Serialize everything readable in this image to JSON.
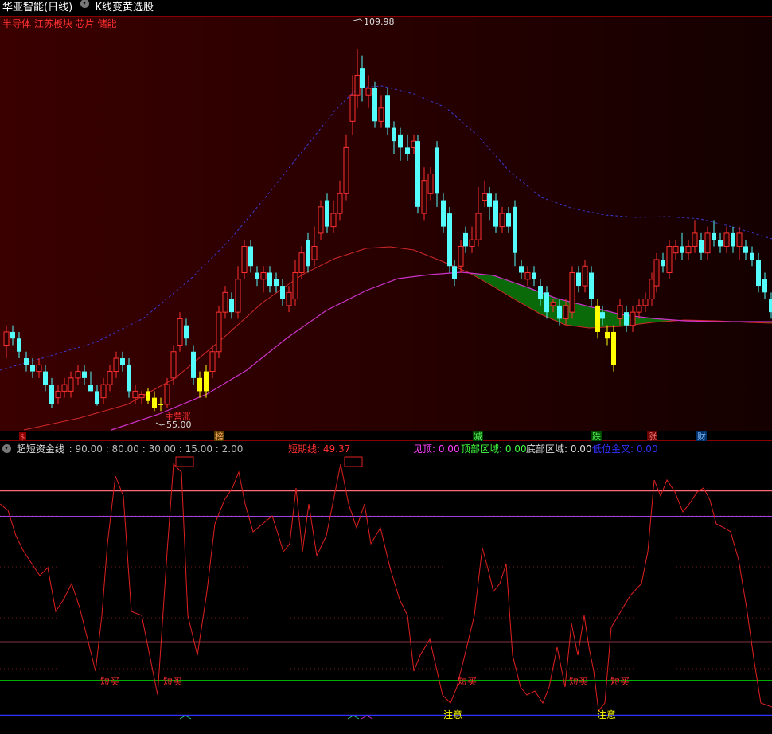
{
  "title_bar": {
    "stock_name": "华亚智能(日线)",
    "indicator_name": "K线变黄选股"
  },
  "main_chart": {
    "concept_tags": "半导体 江苏板块 芯片 储能",
    "high_label": "109.98",
    "low_label": "55.00",
    "marker_text": "主营涨",
    "bottom_badges": [
      "$",
      "榜",
      "减",
      "跌",
      "涨",
      "财"
    ],
    "colors": {
      "background": "#2a0000",
      "candle_up": "#ff3030",
      "candle_down": "#54fcfc",
      "candle_yellow": "#ffff00",
      "cloud": "#007000",
      "upper_curve": "#3030c8",
      "mid_curve": "#e03030",
      "low_curve": "#d030d0"
    }
  },
  "sub_chart": {
    "name": "超短资金线",
    "params": ": 90.00 : 80.00 : 30.00 : 15.00 : 2.00",
    "short_line_label": "短期线: 49.37",
    "see_top_label": "见顶: 0.00",
    "top_zone_label": "顶部区域: 0.00",
    "bottom_zone_label": "底部区域: 0.00",
    "golden_cross_label": "低位金叉: 0.00",
    "annotations": {
      "short_buy": "短买",
      "attention": "注意"
    },
    "colors": {
      "line": "#e02020",
      "level_90": "#ff6070",
      "level_80": "#c040ff",
      "level_30": "#ff6070",
      "level_15": "#00c000",
      "level_2": "#3030ff"
    }
  }
}
